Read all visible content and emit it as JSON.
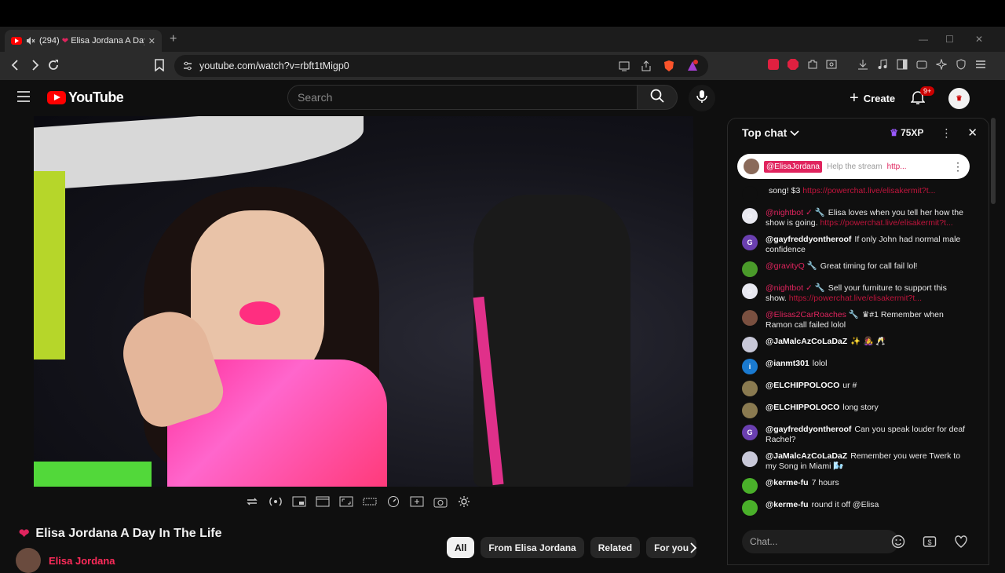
{
  "browser": {
    "tab": {
      "count_label": "(294)",
      "title": "Elisa Jordana A Day"
    },
    "url": "youtube.com/watch?v=rbft1tMigp0"
  },
  "header": {
    "logo_text": "YouTube",
    "search_placeholder": "Search",
    "create_label": "Create",
    "notifications": "9+"
  },
  "video": {
    "title": "Elisa Jordana A Day In The Life",
    "channel": "Elisa Jordana"
  },
  "chips": [
    "All",
    "From Elisa Jordana",
    "Related",
    "For you"
  ],
  "chat": {
    "title": "Top chat",
    "xp": "75XP",
    "pinned": {
      "author": "@ElisaJordana",
      "text": "Help the stream",
      "link": "http..."
    },
    "messages": [
      {
        "author": "",
        "text": "song! $3 ",
        "link": "https://powerchat.live/elisakermit?t...",
        "avatar": "",
        "color": "#0f0f0f",
        "mod": false
      },
      {
        "author": "@nightbot ✓ 🔧",
        "text": "Elisa loves when you tell her how the show is going. ",
        "link": "https://powerchat.live/elisakermit?t...",
        "avatar": "☺",
        "color": "#e8e8f0",
        "mod": true
      },
      {
        "author": "@gayfreddyontheroof",
        "text": "If only John had normal male confidence",
        "link": "",
        "avatar": "G",
        "color": "#6a3fb0",
        "mod": false
      },
      {
        "author": "@gravityQ 🔧",
        "text": "Great timing for call fail lol!",
        "link": "",
        "avatar": "",
        "color": "#4a9a2a",
        "mod": true
      },
      {
        "author": "@nightbot ✓ 🔧",
        "text": "Sell your furniture to support this show. ",
        "link": "https://powerchat.live/elisakermit?t...",
        "avatar": "☺",
        "color": "#e8e8f0",
        "mod": true
      },
      {
        "author": "@Elisas2CarRoaches 🔧",
        "text": "♛#1  Remember when Ramon call failed lolol",
        "link": "",
        "avatar": "",
        "color": "#7a5040",
        "mod": true
      },
      {
        "author": "@JaMalcAzCoLaDaZ",
        "text": "✨ 👩‍🎤 🥂",
        "link": "",
        "avatar": "",
        "color": "#c8c8d8",
        "mod": false
      },
      {
        "author": "@ianmt301",
        "text": "lolol",
        "link": "",
        "avatar": "i",
        "color": "#1a7ad0",
        "mod": false
      },
      {
        "author": "@ELCHIPPOLOCO",
        "text": "ur #",
        "link": "",
        "avatar": "",
        "color": "#8a7a50",
        "mod": false
      },
      {
        "author": "@ELCHIPPOLOCO",
        "text": "long story",
        "link": "",
        "avatar": "",
        "color": "#8a7a50",
        "mod": false
      },
      {
        "author": "@gayfreddyontheroof",
        "text": "Can you speak louder for deaf Rachel?",
        "link": "",
        "avatar": "G",
        "color": "#6a3fb0",
        "mod": false
      },
      {
        "author": "@JaMalcAzCoLaDaZ",
        "text": "Remember you were Twerk to my Song in Miami 🌬️",
        "link": "",
        "avatar": "",
        "color": "#c8c8d8",
        "mod": false
      },
      {
        "author": "@kerme-fu",
        "text": "7 hours",
        "link": "",
        "avatar": "",
        "color": "#4ab02a",
        "mod": false
      },
      {
        "author": "@kerme-fu",
        "text": "round it off @Elisa",
        "link": "",
        "avatar": "",
        "color": "#4ab02a",
        "mod": false
      }
    ],
    "input_placeholder": "Chat..."
  }
}
